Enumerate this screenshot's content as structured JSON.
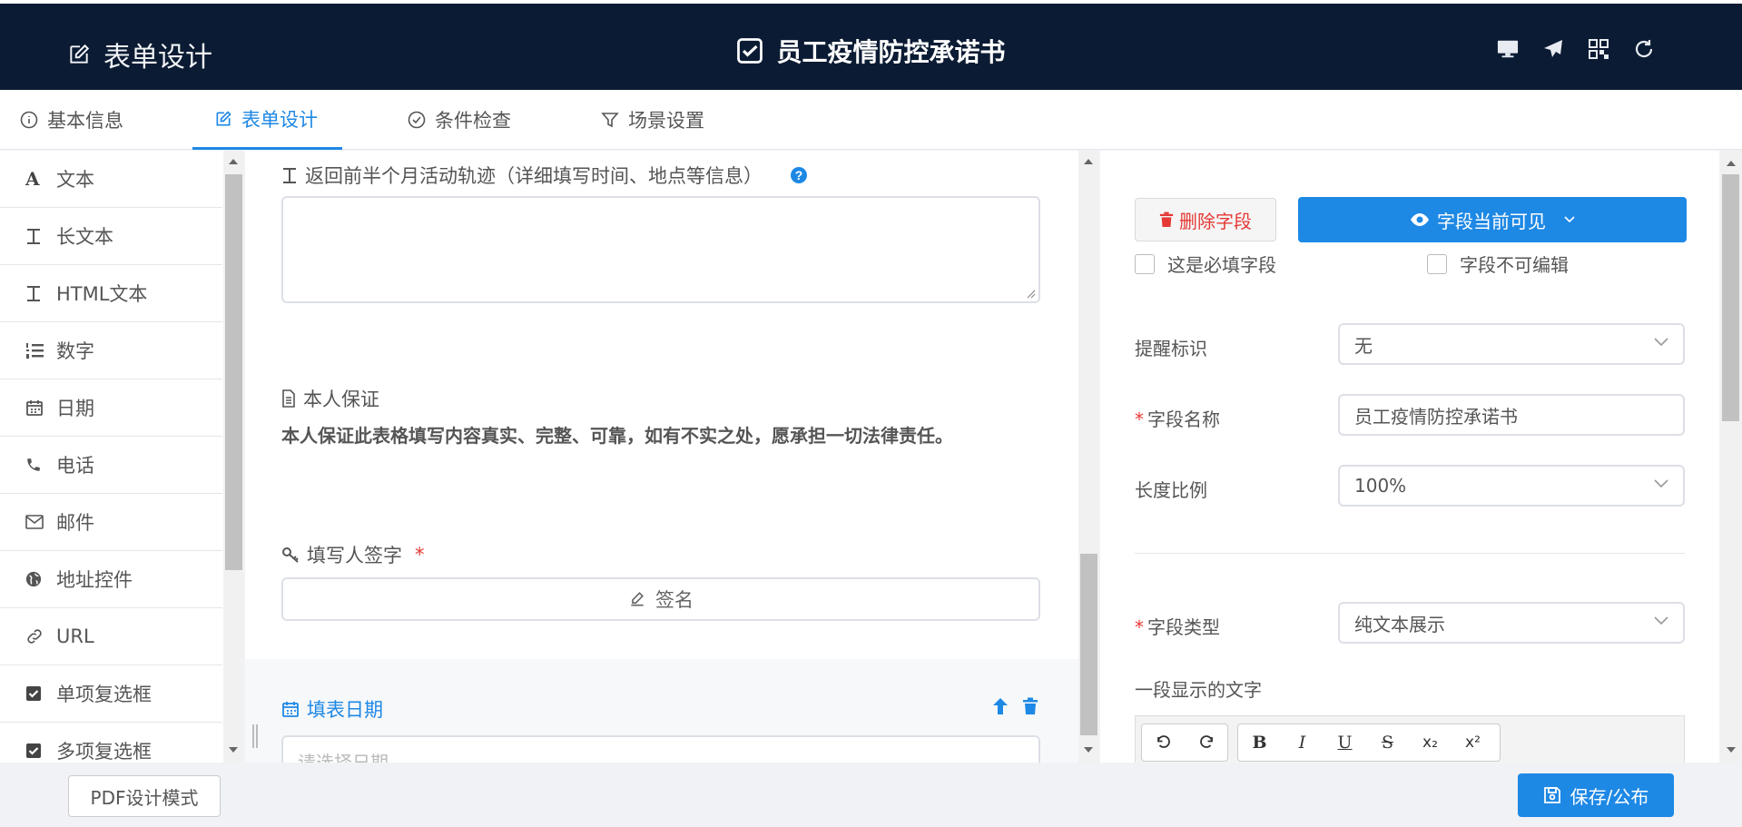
{
  "header": {
    "left_title": "表单设计",
    "center_title": "员工疫情防控承诺书",
    "icons": [
      "desktop-icon",
      "send-icon",
      "qrcode-icon",
      "refresh-icon"
    ]
  },
  "tabs": [
    {
      "label": "基本信息",
      "icon": "info-icon",
      "active": false
    },
    {
      "label": "表单设计",
      "icon": "edit-icon",
      "active": true
    },
    {
      "label": "条件检查",
      "icon": "check-circle-icon",
      "active": false
    },
    {
      "label": "场景设置",
      "icon": "filter-icon",
      "active": false
    }
  ],
  "sidebar": {
    "items": [
      {
        "label": "文本",
        "icon": "font-icon"
      },
      {
        "label": "长文本",
        "icon": "text-icon"
      },
      {
        "label": "HTML文本",
        "icon": "text-icon"
      },
      {
        "label": "数字",
        "icon": "list-ol-icon"
      },
      {
        "label": "日期",
        "icon": "calendar-icon"
      },
      {
        "label": "电话",
        "icon": "phone-icon"
      },
      {
        "label": "邮件",
        "icon": "mail-icon"
      },
      {
        "label": "地址控件",
        "icon": "globe-icon"
      },
      {
        "label": "URL",
        "icon": "link-icon"
      },
      {
        "label": "单项复选框",
        "icon": "checkbox-icon"
      },
      {
        "label": "多项复选框",
        "icon": "checkbox-icon"
      }
    ]
  },
  "canvas": {
    "field1_label": "返回前半个月活动轨迹（详细填写时间、地点等信息）",
    "field2_label": "本人保证",
    "field2_text": "本人保证此表格填写内容真实、完整、可靠，如有不实之处，愿承担一切法律责任。",
    "field3_label": "填写人签字",
    "field3_required": "*",
    "sign_button": "签名",
    "field4_label": "填表日期",
    "date_placeholder": "请选择日期"
  },
  "props": {
    "delete_button": "删除字段",
    "visible_button": "字段当前可见",
    "required_checkbox": "这是必填字段",
    "readonly_checkbox": "字段不可编辑",
    "reminder_label": "提醒标识",
    "reminder_value": "无",
    "name_label": "字段名称",
    "name_value": "员工疫情防控承诺书",
    "width_label": "长度比例",
    "width_value": "100%",
    "type_label": "字段类型",
    "type_value": "纯文本展示",
    "text_label": "一段显示的文字",
    "required_mark": "*",
    "editor_buttons": [
      "B",
      "I",
      "U",
      "S",
      "x₂",
      "x²"
    ]
  },
  "footer": {
    "pdf_button": "PDF设计模式",
    "save_button": "保存/公布"
  },
  "colors": {
    "header_bg": "#0b1b33",
    "accent": "#1e88e5",
    "danger": "#e53935"
  }
}
